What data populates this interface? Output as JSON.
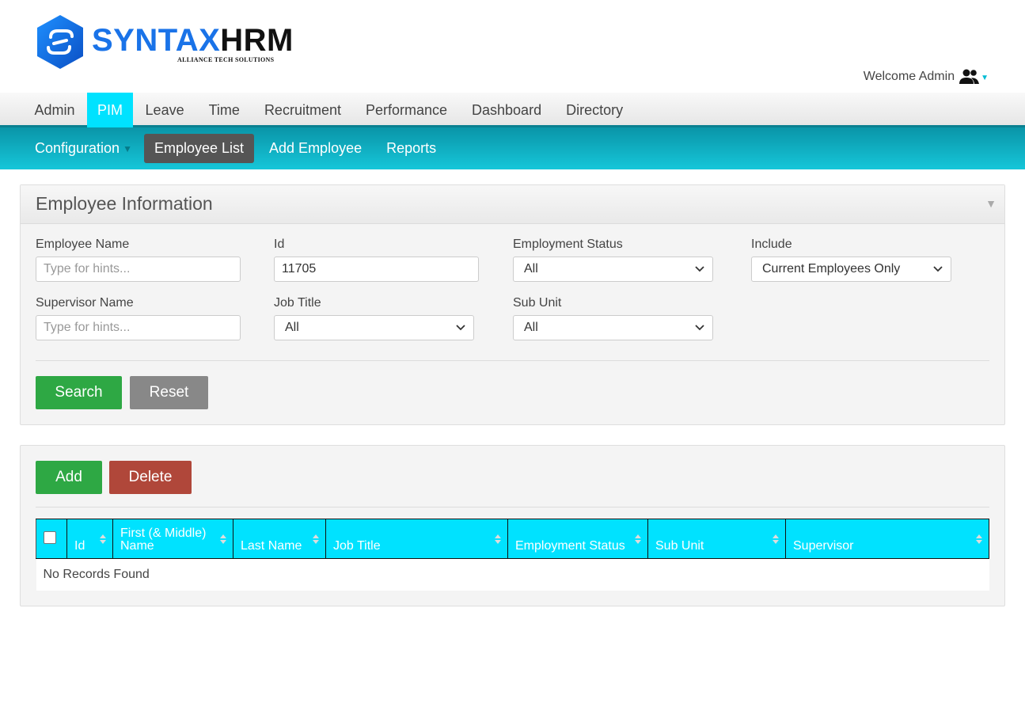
{
  "brand": {
    "name_part1": "SYNTAX",
    "name_part2": "HRM",
    "tagline": "ALLIANCE TECH SOLUTIONS"
  },
  "header": {
    "welcome_text": "Welcome Admin",
    "user_icon": "users-icon"
  },
  "main_menu": {
    "items": [
      {
        "label": "Admin"
      },
      {
        "label": "PIM"
      },
      {
        "label": "Leave"
      },
      {
        "label": "Time"
      },
      {
        "label": "Recruitment"
      },
      {
        "label": "Performance"
      },
      {
        "label": "Dashboard"
      },
      {
        "label": "Directory"
      }
    ],
    "active": "PIM"
  },
  "sub_menu": {
    "items": [
      {
        "label": "Configuration"
      },
      {
        "label": "Employee List"
      },
      {
        "label": "Add Employee"
      },
      {
        "label": "Reports"
      }
    ],
    "active": "Employee List"
  },
  "search_panel": {
    "title": "Employee Information",
    "fields": {
      "employee_name": {
        "label": "Employee Name",
        "value": "",
        "placeholder": "Type for hints..."
      },
      "id": {
        "label": "Id",
        "value": "11705",
        "placeholder": ""
      },
      "employment_status": {
        "label": "Employment Status",
        "selected": "All"
      },
      "include": {
        "label": "Include",
        "selected": "Current Employees Only"
      },
      "supervisor_name": {
        "label": "Supervisor Name",
        "value": "",
        "placeholder": "Type for hints..."
      },
      "job_title": {
        "label": "Job Title",
        "selected": "All"
      },
      "sub_unit": {
        "label": "Sub Unit",
        "selected": "All"
      }
    },
    "buttons": {
      "search": "Search",
      "reset": "Reset"
    }
  },
  "list_panel": {
    "buttons": {
      "add": "Add",
      "delete": "Delete"
    },
    "columns": [
      {
        "label": "Id"
      },
      {
        "label": "First (& Middle) Name"
      },
      {
        "label": "Last Name"
      },
      {
        "label": "Job Title"
      },
      {
        "label": "Employment Status"
      },
      {
        "label": "Sub Unit"
      },
      {
        "label": "Supervisor"
      }
    ],
    "empty_message": "No Records Found"
  },
  "colors": {
    "accent_cyan": "#00e2ff",
    "submenu_teal": "#0a95a8",
    "button_green": "#2ea844",
    "button_grey": "#888888",
    "button_red": "#b0473a",
    "brand_blue": "#1a73e8"
  }
}
